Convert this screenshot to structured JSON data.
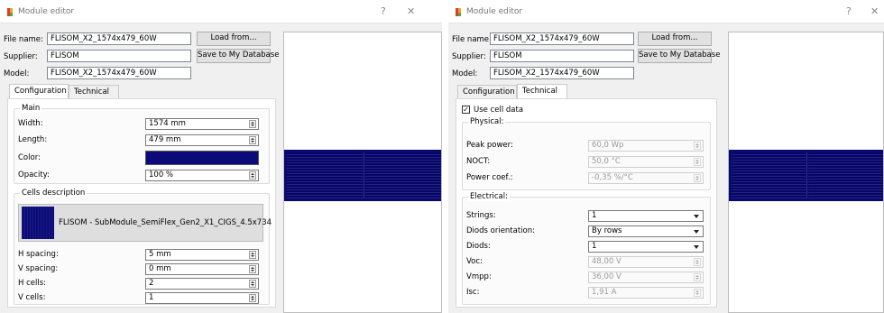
{
  "window_title": "Module editor",
  "help_glyph": "?",
  "close_glyph": "✕",
  "labels": {
    "file_name": "File name:",
    "supplier": "Supplier:",
    "model": "Model:"
  },
  "values": {
    "file_name": "FLISOM_X2_1574x479_60W",
    "supplier": "FLISOM",
    "model": "FLISOM_X2_1574x479_60W"
  },
  "buttons": {
    "load": "Load from...",
    "save": "Save to My Database"
  },
  "tabs": [
    "Configuration",
    "Technical"
  ],
  "config": {
    "main_title": "Main",
    "fields": [
      {
        "label": "Width:",
        "value": "1574 mm"
      },
      {
        "label": "Length:",
        "value": "479 mm"
      },
      {
        "label": "Color:",
        "value": ""
      },
      {
        "label": "Opacity:",
        "value": "100 %"
      }
    ],
    "color_swatch": "#0a0a78",
    "cells_title": "Cells description",
    "cell_name": "FLISOM - SubModule_SemiFlex_Gen2_X1_CIGS_4.5x734",
    "cell_fields": [
      {
        "label": "H spacing:",
        "value": "5 mm"
      },
      {
        "label": "V spacing:",
        "value": "0 mm"
      },
      {
        "label": "H cells:",
        "value": "2"
      },
      {
        "label": "V cells:",
        "value": "1"
      }
    ]
  },
  "technical": {
    "use_cell_data": "Use cell data",
    "checkmark": "✓",
    "physical_title": "Physical:",
    "physical": [
      {
        "label": "Peak power:",
        "value": "60,0 Wp"
      },
      {
        "label": "NOCT:",
        "value": "50,0 °C"
      },
      {
        "label": "Power coef.:",
        "value": "-0,35 %/°C"
      }
    ],
    "electrical_title": "Electrical:",
    "electrical": [
      {
        "label": "Strings:",
        "value": "1",
        "type": "combo"
      },
      {
        "label": "Diods orientation:",
        "value": "By rows",
        "type": "combo"
      },
      {
        "label": "Diods:",
        "value": "1",
        "type": "combo"
      },
      {
        "label": "Voc:",
        "value": "48,00 V",
        "type": "spin"
      },
      {
        "label": "Vmpp:",
        "value": "36,00 V",
        "type": "spin"
      },
      {
        "label": "Isc:",
        "value": "1,91 A",
        "type": "spin"
      }
    ]
  },
  "colors": {
    "module": "#0a0a6e",
    "logo_red": "#d9412b",
    "logo_orange": "#f0a12d",
    "logo_green": "#5aa832"
  }
}
